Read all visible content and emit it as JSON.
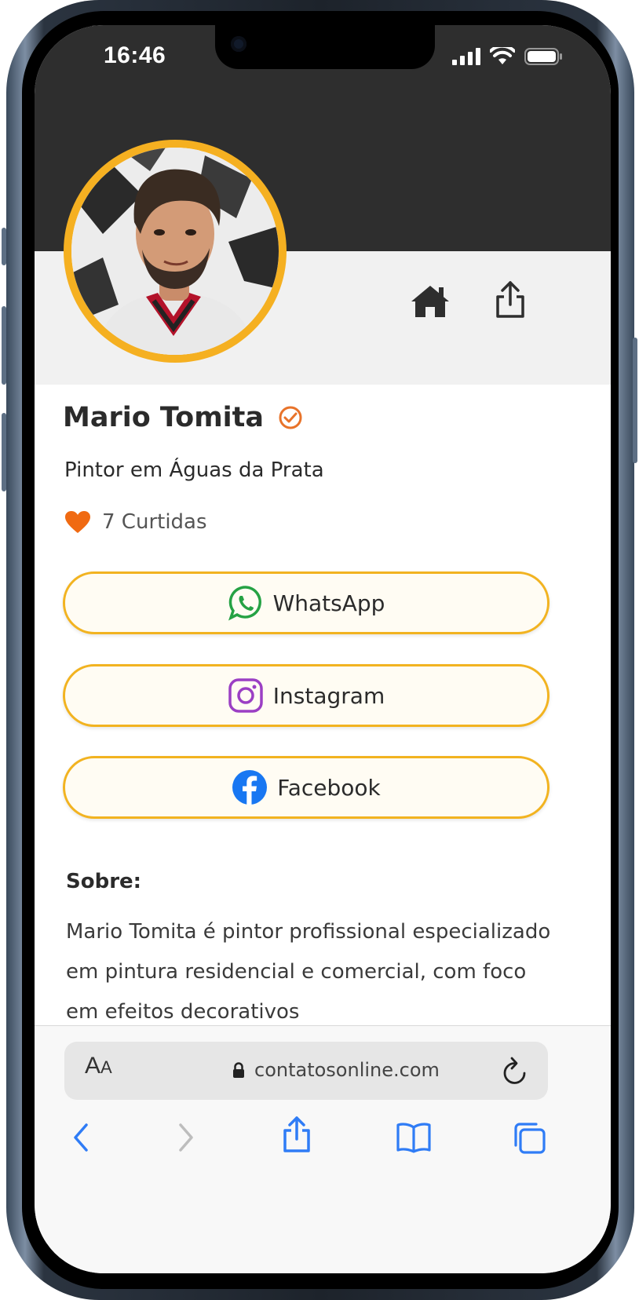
{
  "status_bar": {
    "time": "16:46"
  },
  "profile": {
    "name": "Mario Tomita",
    "subtitle": "Pintor em Águas da Prata",
    "likes": "7 Curtidas"
  },
  "buttons": [
    {
      "label": "WhatsApp",
      "icon": "whatsapp-icon",
      "color": "#25a244"
    },
    {
      "label": "Instagram",
      "icon": "instagram-icon",
      "color": "#9b3fc4"
    },
    {
      "label": "Facebook",
      "icon": "facebook-icon",
      "color": "#1877f2"
    }
  ],
  "about": {
    "title": "Sobre:",
    "text": "Mario Tomita é pintor profissional especializado em pintura residencial e comercial, com foco em efeitos decorativos"
  },
  "browser": {
    "aa_label_big": "A",
    "aa_label_small": "A",
    "url": "contatosonline.com"
  },
  "colors": {
    "accent": "#f2b320",
    "verified": "#e8732a",
    "heart": "#f06a12",
    "header_dark": "#2e2e2e",
    "safari_blue": "#2f7cf6"
  }
}
